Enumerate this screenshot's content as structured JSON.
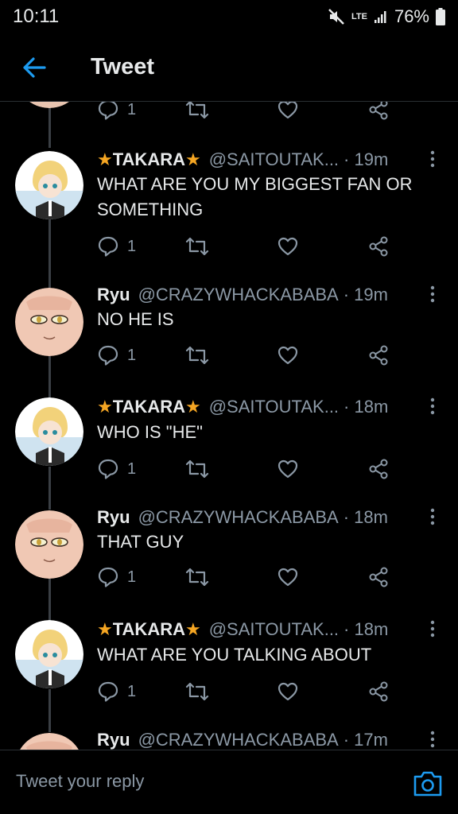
{
  "status_bar": {
    "time": "10:11",
    "network": "LTE",
    "battery": "76%"
  },
  "header": {
    "title": "Tweet",
    "back_icon": "arrow-left-icon"
  },
  "colors": {
    "accent": "#1d9bf0",
    "star": "#f5a623",
    "muted": "#8b98a5",
    "text": "#e7e9ea",
    "background": "#000000"
  },
  "top_actions": {
    "reply_count": "1"
  },
  "tweets": [
    {
      "author": "TAKARA",
      "star_left": "★",
      "star_right": "★",
      "handle": "@SAITOUTAK...",
      "time": "· 19m",
      "text": "WHAT ARE YOU MY BIGGEST FAN OR SOMETHING",
      "reply_count": "1"
    },
    {
      "author": "Ryu",
      "handle": "@CRAZYWHACKABABA",
      "time": "· 19m",
      "text": "NO HE IS",
      "reply_count": "1"
    },
    {
      "author": "TAKARA",
      "star_left": "★",
      "star_right": "★",
      "handle": "@SAITOUTAK...",
      "time": "· 18m",
      "text": "WHO IS \"HE\"",
      "reply_count": "1"
    },
    {
      "author": "Ryu",
      "handle": "@CRAZYWHACKABABA",
      "time": "· 18m",
      "text": "THAT GUY",
      "reply_count": "1"
    },
    {
      "author": "TAKARA",
      "star_left": "★",
      "star_right": "★",
      "handle": "@SAITOUTAK...",
      "time": "· 18m",
      "text": "WHAT ARE YOU TALKING ABOUT",
      "reply_count": "1"
    },
    {
      "author": "Ryu",
      "handle": "@CRAZYWHACKABABA",
      "time": "· 17m"
    }
  ],
  "reply": {
    "placeholder": "Tweet your reply"
  }
}
